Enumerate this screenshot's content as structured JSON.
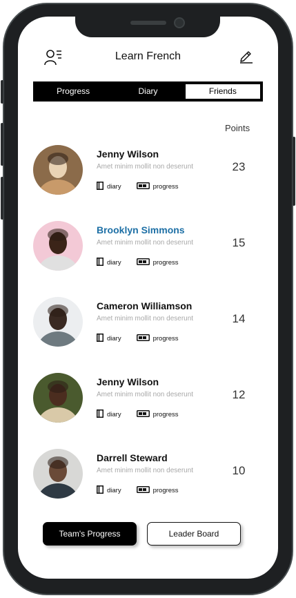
{
  "header": {
    "title": "Learn French",
    "left_icon": "user-list-icon",
    "right_icon": "edit-icon"
  },
  "tabs": [
    {
      "label": "Progress",
      "active": false
    },
    {
      "label": "Diary",
      "active": false
    },
    {
      "label": "Friends",
      "active": true
    }
  ],
  "points_header": "Points",
  "friends": [
    {
      "name": "Jenny Wilson",
      "subtitle": "Amet minim mollit non deserunt",
      "diary_label": "diary",
      "progress_label": "progress",
      "points": "23",
      "highlight": false,
      "avatar_colors": [
        "#8b6b4a",
        "#e9d3b5",
        "#c89a6a"
      ]
    },
    {
      "name": "Brooklyn Simmons",
      "subtitle": "Amet minim mollit non deserunt",
      "diary_label": "diary",
      "progress_label": "progress",
      "points": "15",
      "highlight": true,
      "avatar_colors": [
        "#f3c9d6",
        "#3b2418",
        "#e0e0e0"
      ]
    },
    {
      "name": "Cameron Williamson",
      "subtitle": "Amet minim mollit non deserunt",
      "diary_label": "diary",
      "progress_label": "progress",
      "points": "14",
      "highlight": false,
      "avatar_colors": [
        "#eceef0",
        "#3a2a22",
        "#6e7a80"
      ]
    },
    {
      "name": "Jenny Wilson",
      "subtitle": "Amet minim mollit non deserunt",
      "diary_label": "diary",
      "progress_label": "progress",
      "points": "12",
      "highlight": false,
      "avatar_colors": [
        "#4a5a2e",
        "#4b2d1f",
        "#d9c9a8"
      ]
    },
    {
      "name": "Darrell Steward",
      "subtitle": "Amet minim mollit non deserunt",
      "diary_label": "diary",
      "progress_label": "progress",
      "points": "10",
      "highlight": false,
      "avatar_colors": [
        "#d8d8d6",
        "#6a4a38",
        "#2f3a44"
      ]
    }
  ],
  "buttons": {
    "team_progress": "Team's Progress",
    "leader_board": "Leader Board"
  },
  "colors": {
    "accent_name": "#1d6fa5",
    "tab_bar": "#000000",
    "device_frame": "#1e2022"
  }
}
